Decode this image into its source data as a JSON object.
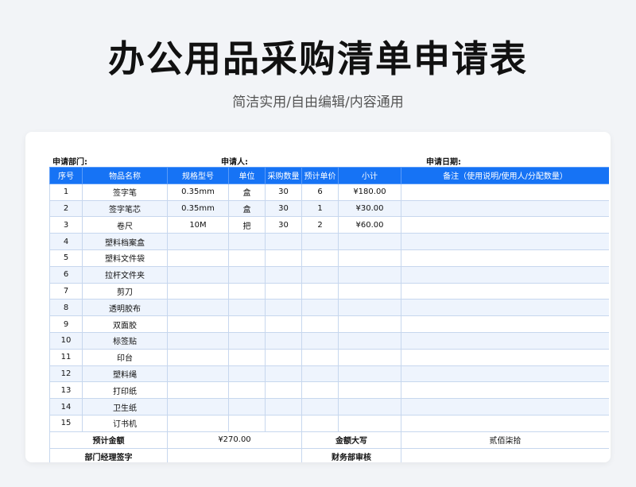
{
  "header": {
    "title": "办公用品采购清单申请表",
    "subtitle": "简洁实用/自由编辑/内容通用"
  },
  "info": {
    "department_label": "申请部门:",
    "applicant_label": "申请人:",
    "date_label": "申请日期:"
  },
  "table": {
    "columns": [
      "序号",
      "物品名称",
      "规格型号",
      "单位",
      "采购数量",
      "预计单价",
      "小计",
      "备注（使用说明/使用人/分配数量）"
    ],
    "rows": [
      [
        "1",
        "签字笔",
        "0.35mm",
        "盒",
        "30",
        "6",
        "¥180.00",
        ""
      ],
      [
        "2",
        "签字笔芯",
        "0.35mm",
        "盒",
        "30",
        "1",
        "¥30.00",
        ""
      ],
      [
        "3",
        "卷尺",
        "10M",
        "把",
        "30",
        "2",
        "¥60.00",
        ""
      ],
      [
        "4",
        "塑料档案盒",
        "",
        "",
        "",
        "",
        "",
        ""
      ],
      [
        "5",
        "塑料文件袋",
        "",
        "",
        "",
        "",
        "",
        ""
      ],
      [
        "6",
        "拉杆文件夹",
        "",
        "",
        "",
        "",
        "",
        ""
      ],
      [
        "7",
        "剪刀",
        "",
        "",
        "",
        "",
        "",
        ""
      ],
      [
        "8",
        "透明胶布",
        "",
        "",
        "",
        "",
        "",
        ""
      ],
      [
        "9",
        "双面胶",
        "",
        "",
        "",
        "",
        "",
        ""
      ],
      [
        "10",
        "标签贴",
        "",
        "",
        "",
        "",
        "",
        ""
      ],
      [
        "11",
        "印台",
        "",
        "",
        "",
        "",
        "",
        ""
      ],
      [
        "12",
        "塑料绳",
        "",
        "",
        "",
        "",
        "",
        ""
      ],
      [
        "13",
        "打印纸",
        "",
        "",
        "",
        "",
        "",
        ""
      ],
      [
        "14",
        "卫生纸",
        "",
        "",
        "",
        "",
        "",
        ""
      ],
      [
        "15",
        "订书机",
        "",
        "",
        "",
        "",
        "",
        ""
      ]
    ],
    "footer": {
      "total_label": "预计金额",
      "total_value": "¥270.00",
      "amount_words_label": "金额大写",
      "amount_words_value": "贰佰柒拾",
      "manager_label": "部门经理签字",
      "finance_label": "财务部审核"
    }
  },
  "colors": {
    "header_bg": "#1673f5",
    "row_alt": "#eef4fd",
    "border": "#c7d7ee"
  }
}
